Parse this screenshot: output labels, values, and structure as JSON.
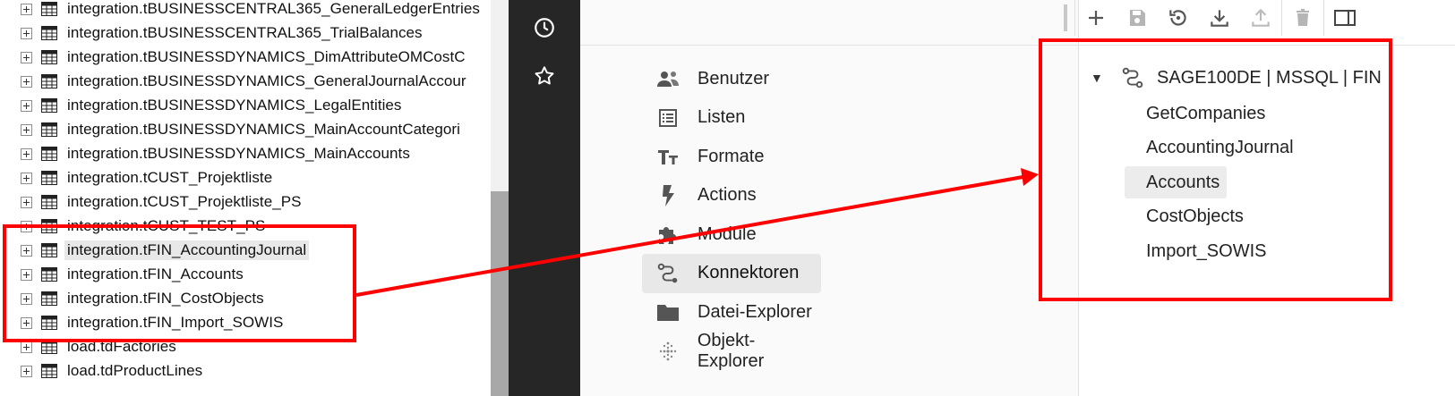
{
  "db_tree": {
    "rows": [
      {
        "label": "integration.tBUSINESSCENTRAL365_GeneralLedgerEntries",
        "selected": false
      },
      {
        "label": "integration.tBUSINESSCENTRAL365_TrialBalances",
        "selected": false
      },
      {
        "label": "integration.tBUSINESSDYNAMICS_DimAttributeOMCostC",
        "selected": false
      },
      {
        "label": "integration.tBUSINESSDYNAMICS_GeneralJournalAccour",
        "selected": false
      },
      {
        "label": "integration.tBUSINESSDYNAMICS_LegalEntities",
        "selected": false
      },
      {
        "label": "integration.tBUSINESSDYNAMICS_MainAccountCategori",
        "selected": false
      },
      {
        "label": "integration.tBUSINESSDYNAMICS_MainAccounts",
        "selected": false
      },
      {
        "label": "integration.tCUST_Projektliste",
        "selected": false
      },
      {
        "label": "integration.tCUST_Projektliste_PS",
        "selected": false
      },
      {
        "label": "integration.tCUST_TEST_PS",
        "selected": false
      },
      {
        "label": "integration.tFIN_AccountingJournal",
        "selected": true
      },
      {
        "label": "integration.tFIN_Accounts",
        "selected": false
      },
      {
        "label": "integration.tFIN_CostObjects",
        "selected": false
      },
      {
        "label": "integration.tFIN_Import_SOWIS",
        "selected": false
      },
      {
        "label": "load.tdFactories",
        "selected": false
      },
      {
        "label": "load.tdProductLines",
        "selected": false
      }
    ]
  },
  "rail": {
    "icons": [
      "history-icon",
      "star-icon"
    ]
  },
  "menu": {
    "items": [
      {
        "label": "Benutzer",
        "icon": "users-icon",
        "active": false
      },
      {
        "label": "Listen",
        "icon": "list-icon",
        "active": false
      },
      {
        "label": "Formate",
        "icon": "text-format-icon",
        "active": false
      },
      {
        "label": "Actions",
        "icon": "bolt-icon",
        "active": false
      },
      {
        "label": "Module",
        "icon": "puzzle-icon",
        "active": false
      },
      {
        "label": "Konnektoren",
        "icon": "connector-icon",
        "active": true
      },
      {
        "label": "Datei-Explorer",
        "icon": "folder-icon",
        "active": false
      },
      {
        "label": "Objekt-Explorer",
        "icon": "dots-grid-icon",
        "active": false
      }
    ]
  },
  "toolbar": {
    "buttons": [
      "add-icon",
      "save-icon",
      "reset-icon",
      "download-icon",
      "upload-icon",
      "delete-icon",
      "panel-icon"
    ]
  },
  "connector": {
    "root_label": "SAGE100DE | MSSQL | FIN",
    "children": [
      {
        "label": "GetCompanies",
        "selected": false
      },
      {
        "label": "AccountingJournal",
        "selected": false
      },
      {
        "label": "Accounts",
        "selected": true
      },
      {
        "label": "CostObjects",
        "selected": false
      },
      {
        "label": "Import_SOWIS",
        "selected": false
      }
    ]
  },
  "colors": {
    "annotation": "#ff0000",
    "rail": "#262626",
    "menu_bg": "#fafafa",
    "selected_bg": "#e8e8e8"
  }
}
